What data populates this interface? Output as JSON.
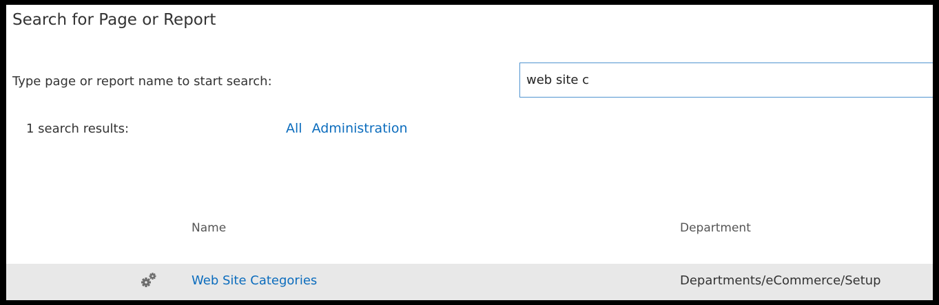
{
  "page": {
    "title": "Search for Page or Report"
  },
  "search": {
    "label": "Type page or report name to start search:",
    "value": "web site c"
  },
  "results": {
    "count_label": "1 search results:",
    "filters": [
      "All",
      "Administration"
    ]
  },
  "table": {
    "columns": {
      "name": "Name",
      "department": "Department"
    },
    "rows": [
      {
        "icon": "gears-icon",
        "name": "Web Site Categories",
        "department": "Departments/eCommerce/Setup"
      }
    ]
  },
  "colors": {
    "link": "#0b6cbd",
    "input_border": "#4f93cf",
    "row_highlight": "#e8e8e8",
    "frame_border": "#000000"
  }
}
